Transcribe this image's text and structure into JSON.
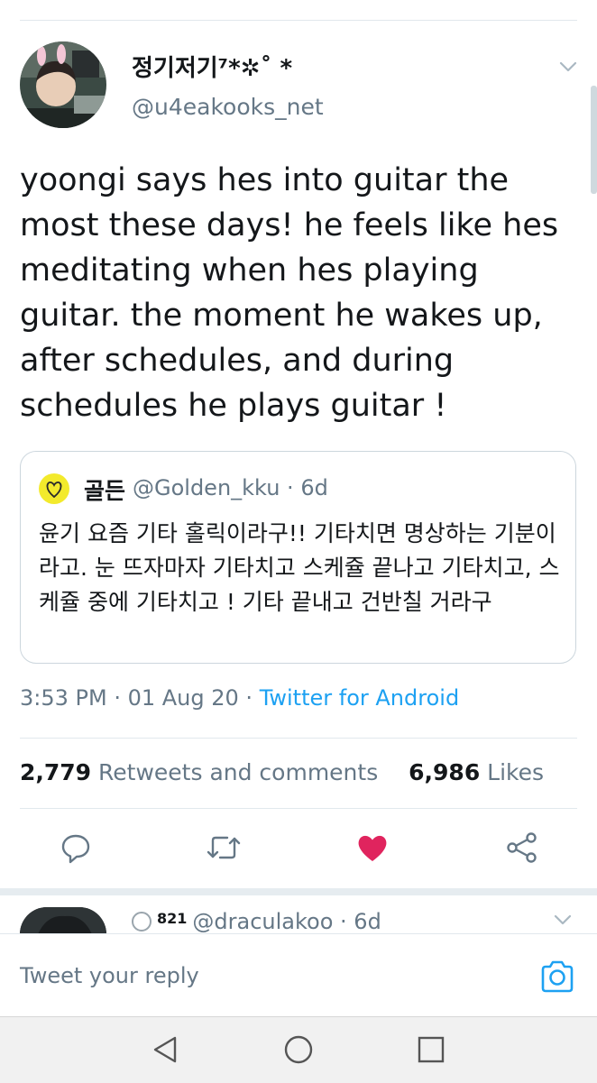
{
  "tweet": {
    "display_name": "정기저기⁷*✲˚ *",
    "handle": "@u4eakooks_net",
    "text": "yoongi says hes into guitar the most these days! he feels like hes meditating when hes playing guitar. the moment he wakes up, after schedules, and during schedules he plays guitar !",
    "timestamp": "3:53 PM · 01 Aug 20 · ",
    "source": "Twitter for Android",
    "retweets_count": "2,779",
    "retweets_label": "Retweets and comments",
    "likes_count": "6,986",
    "likes_label": "Likes"
  },
  "quoted_tweet": {
    "name": "골든",
    "meta": "@Golden_kku · 6d",
    "text": "윤기 요즘 기타 홀릭이라구!! 기타치면 명상하는 기분이라고. 눈 뜨자마자 기타치고 스케쥴 끝나고 기타치고, 스케쥴 중에 기타치고 ! 기타 끝내고 건반칠 거라구"
  },
  "actions": {
    "reply_icon": "reply-icon",
    "retweet_icon": "retweet-icon",
    "like_icon": "heart-icon",
    "share_icon": "share-icon",
    "like_color": "#e0245e"
  },
  "next_reply": {
    "badge_count": "821",
    "handle_time": "@draculakoo · 6d"
  },
  "reply_bar": {
    "placeholder": "Tweet your reply"
  },
  "colors": {
    "accent": "#1da1f2",
    "secondary_text": "#657786",
    "like": "#e0245e"
  }
}
